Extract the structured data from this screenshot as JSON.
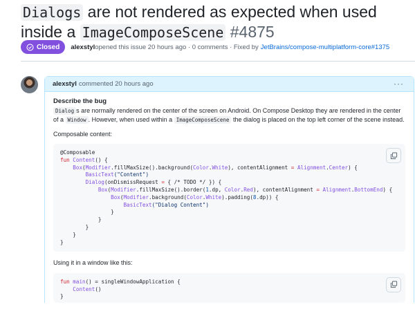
{
  "issue": {
    "title_code1": "Dialogs",
    "title_text1": " are not rendered as expected when used inside a ",
    "title_code2": "ImageComposeScene",
    "number": "#4875",
    "status": "Closed",
    "author": "alexstyl",
    "meta_text": " opened this issue 20 hours ago · 0 comments · Fixed by",
    "fixed_by": "JetBrains/compose-multiplatform-core#1375"
  },
  "comment": {
    "author": "alexstyl",
    "header_text": "commented 20 hours ago",
    "menu": "···",
    "heading": "Describe the bug",
    "p1": {
      "c1": "Dialog",
      "t1": "s are normally rendered on the center of the screen on Android. On Compose Desktop they are rendered in the center of a ",
      "c2": "Window",
      "t2": ". However, when used within a ",
      "c3": "ImageComposeScene",
      "t3": " the dialog is placed on the top left corner of the scene instead."
    },
    "p2": "Composable content:",
    "p3": "Using it in a window like this:",
    "colors": {
      "k": "#cf222e",
      "f": "#8250df",
      "n": "#0550ae",
      "s": "#0a3069",
      "p": "#1f2328"
    },
    "code1": [
      [
        [
          "@Composable",
          "p"
        ]
      ],
      [
        [
          "fun ",
          "k"
        ],
        [
          "Content",
          "f"
        ],
        [
          "() {",
          "p"
        ]
      ],
      [
        [
          "    ",
          "p"
        ],
        [
          "Box",
          "f"
        ],
        [
          "(",
          "p"
        ],
        [
          "Modifier",
          "f"
        ],
        [
          ".fillMaxSize().background(",
          "p"
        ],
        [
          "Color",
          "f"
        ],
        [
          ".",
          "p"
        ],
        [
          "White",
          "f"
        ],
        [
          "), contentAlignment ",
          "p"
        ],
        [
          "=",
          "k"
        ],
        [
          " ",
          "p"
        ],
        [
          "Alignment",
          "f"
        ],
        [
          ".",
          "p"
        ],
        [
          "Center",
          "f"
        ],
        [
          ") {",
          "p"
        ]
      ],
      [
        [
          "        ",
          "p"
        ],
        [
          "BasicText",
          "f"
        ],
        [
          "(\"Content\")",
          "s"
        ]
      ],
      [
        [
          "        ",
          "p"
        ],
        [
          "Dialog",
          "f"
        ],
        [
          "(onDismissRequest ",
          "p"
        ],
        [
          "=",
          "k"
        ],
        [
          " { /* TODO */ }) {",
          "p"
        ]
      ],
      [
        [
          "            ",
          "p"
        ],
        [
          "Box",
          "f"
        ],
        [
          "(",
          "p"
        ],
        [
          "Modifier",
          "f"
        ],
        [
          ".fillMaxSize().border(",
          "p"
        ],
        [
          "1",
          "n"
        ],
        [
          ".dp, ",
          "p"
        ],
        [
          "Color",
          "f"
        ],
        [
          ".",
          "p"
        ],
        [
          "Red",
          "f"
        ],
        [
          "), contentAlignment ",
          "p"
        ],
        [
          "=",
          "k"
        ],
        [
          " ",
          "p"
        ],
        [
          "Alignment",
          "f"
        ],
        [
          ".",
          "p"
        ],
        [
          "BottomEnd",
          "f"
        ],
        [
          ") {",
          "p"
        ]
      ],
      [
        [
          "                ",
          "p"
        ],
        [
          "Box",
          "f"
        ],
        [
          "(",
          "p"
        ],
        [
          "Modifier",
          "f"
        ],
        [
          ".background(",
          "p"
        ],
        [
          "Color",
          "f"
        ],
        [
          ".",
          "p"
        ],
        [
          "White",
          "f"
        ],
        [
          ").padding(",
          "p"
        ],
        [
          "8",
          "n"
        ],
        [
          ".dp)) {",
          "p"
        ]
      ],
      [
        [
          "                    ",
          "p"
        ],
        [
          "BasicText",
          "f"
        ],
        [
          "(\"Dialog Content\")",
          "s"
        ]
      ],
      [
        [
          "                }",
          "p"
        ]
      ],
      [
        [
          "            }",
          "p"
        ]
      ],
      [
        [
          "        }",
          "p"
        ]
      ],
      [
        [
          "    }",
          "p"
        ]
      ],
      [
        [
          "}",
          "p"
        ]
      ]
    ],
    "code2": [
      [
        [
          "fun ",
          "k"
        ],
        [
          "main",
          "f"
        ],
        [
          "() = singleWindowApplication {",
          "p"
        ]
      ],
      [
        [
          "    ",
          "p"
        ],
        [
          "Content",
          "f"
        ],
        [
          "()",
          "p"
        ]
      ],
      [
        [
          "}",
          "p"
        ]
      ]
    ]
  }
}
